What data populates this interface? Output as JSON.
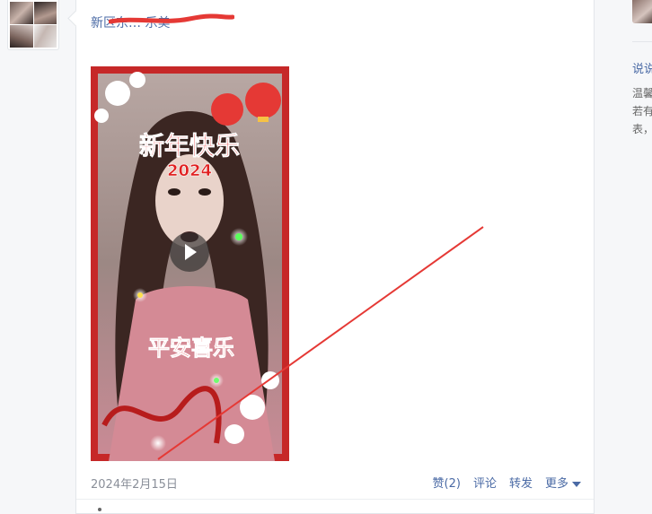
{
  "post": {
    "title": "新区东… 乐美",
    "video_overlay_top": "新年快乐",
    "video_overlay_year": "2024",
    "video_overlay_bottom": "平安喜乐",
    "date": "2024年2月15日"
  },
  "actions": {
    "like": "赞(2)",
    "comment": "评论",
    "forward": "转发",
    "more": "更多"
  },
  "sidebar": {
    "heading": "说说",
    "line1": "温馨",
    "line2": "若有",
    "line3": "表，"
  },
  "colors": {
    "link": "#4a6aa5",
    "annotation": "#e53935",
    "frame": "#c62828"
  },
  "icons": {
    "play": "play-icon",
    "more_caret": "chevron-down-icon"
  }
}
